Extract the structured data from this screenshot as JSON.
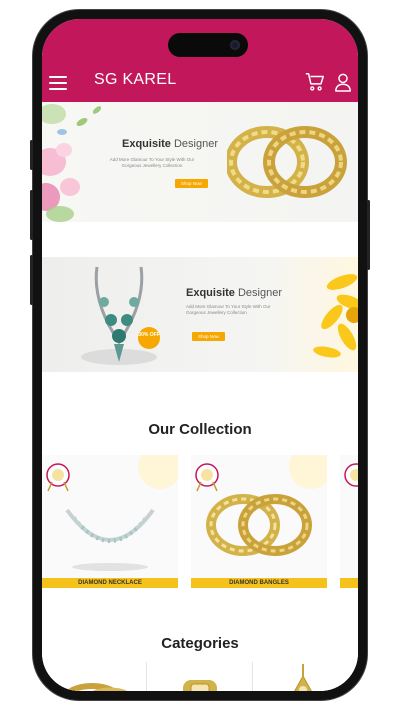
{
  "app": {
    "title": "SG KAREL"
  },
  "banners": [
    {
      "title_bold": "Exquisite",
      "title_light": " Designer",
      "subtitle": "Add More Glamour To Your Style With Our Gorgeous Jewellery Collection",
      "button": "Shop Now"
    },
    {
      "title_bold": "Exquisite",
      "title_light": " Designer",
      "subtitle": "Add More Glamour To Your Style With Our Gorgeous Jewellery Collection",
      "button": "Shop Now",
      "badge": "30% OFF"
    }
  ],
  "collection": {
    "title": "Our Collection",
    "items": [
      {
        "label": "DIAMOND NECKLACE"
      },
      {
        "label": "DIAMOND BANGLES"
      }
    ]
  },
  "categories": {
    "title": "Categories"
  },
  "colors": {
    "primary": "#c2185b",
    "accent": "#f5c21b",
    "button": "#f6a800"
  }
}
